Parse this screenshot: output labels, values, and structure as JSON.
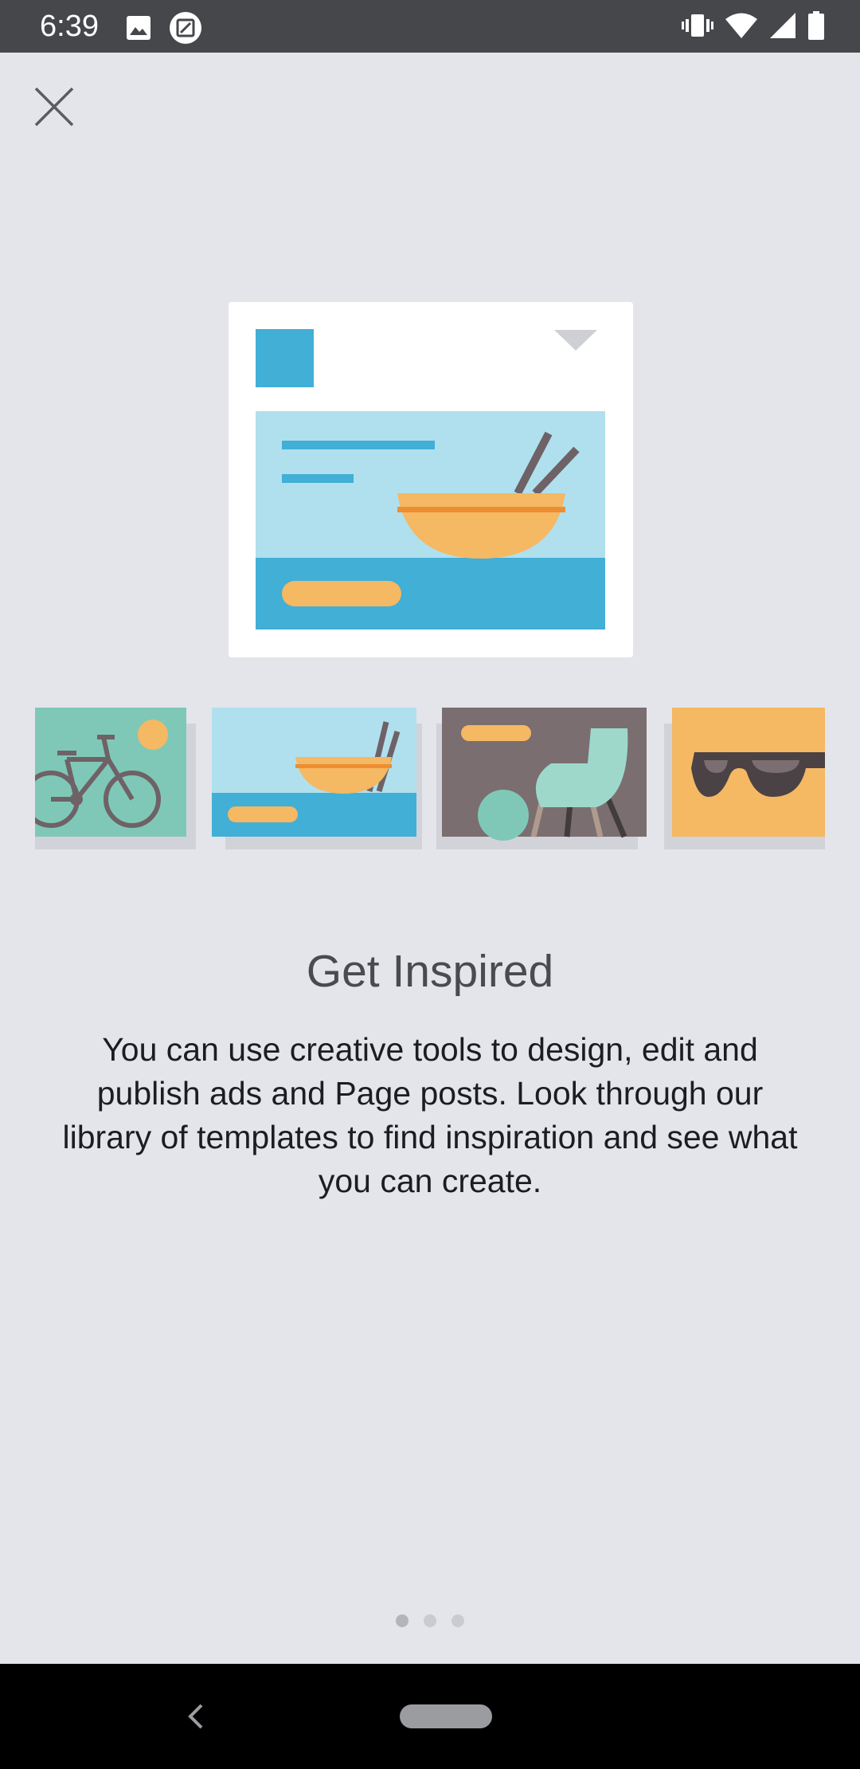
{
  "status_bar": {
    "time": "6:39",
    "left_icons": [
      "image-icon",
      "screenshot-icon"
    ],
    "right_icons": [
      "vibrate-icon",
      "wifi-icon",
      "signal-icon",
      "battery-icon"
    ]
  },
  "header": {
    "close_icon": "close-icon"
  },
  "onboarding": {
    "title": "Get Inspired",
    "description": "You can use creative tools to design, edit and publish ads and Page posts. Look through our library of templates to find inspiration and see what you can create.",
    "page_count": 3,
    "current_page": 1
  },
  "illustration": {
    "hero": "ad-post-template-illustration",
    "gallery": [
      "bicycle-template",
      "food-bowl-template",
      "chair-template",
      "sunglasses-template"
    ]
  },
  "colors": {
    "background": "#e4e5ea",
    "status_bar": "#46474b",
    "accent_blue": "#41afd6",
    "light_blue": "#b0e0ee",
    "orange": "#f5b863",
    "teal": "#7fc8b7",
    "taupe": "#7a6e70",
    "title_text": "#4a4b50",
    "body_text": "#1c1d20"
  },
  "nav_bar": {
    "back_icon": "back-chevron-icon",
    "home_icon": "home-pill-icon"
  }
}
